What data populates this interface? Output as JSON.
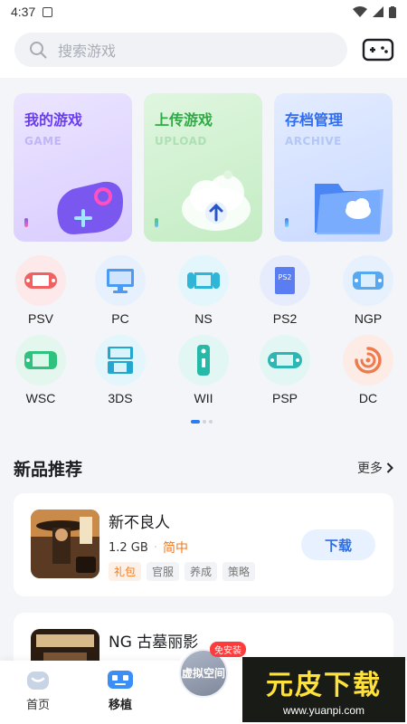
{
  "status": {
    "time": "4:37"
  },
  "search": {
    "placeholder": "搜索游戏"
  },
  "cards": [
    {
      "title": "我的游戏",
      "sub": "GAME"
    },
    {
      "title": "上传游戏",
      "sub": "UPLOAD"
    },
    {
      "title": "存档管理",
      "sub": "ARCHIVE"
    }
  ],
  "platforms": [
    {
      "label": "PSV",
      "icon": "psv-icon"
    },
    {
      "label": "PC",
      "icon": "monitor-icon"
    },
    {
      "label": "NS",
      "icon": "switch-icon"
    },
    {
      "label": "PS2",
      "icon": "ps2-icon"
    },
    {
      "label": "NGP",
      "icon": "ngp-icon"
    },
    {
      "label": "WSC",
      "icon": "wsc-icon"
    },
    {
      "label": "3DS",
      "icon": "3ds-icon"
    },
    {
      "label": "WII",
      "icon": "wii-icon"
    },
    {
      "label": "PSP",
      "icon": "psp-icon"
    },
    {
      "label": "DC",
      "icon": "dc-icon"
    }
  ],
  "section": {
    "title": "新品推荐",
    "more": "更多"
  },
  "games": [
    {
      "name": "新不良人",
      "size": "1.2 GB",
      "lang": "简中",
      "tags": [
        "礼包",
        "官服",
        "养成",
        "策略"
      ],
      "button": "下载"
    },
    {
      "name": "NG 古墓丽影",
      "size": "",
      "lang": "",
      "tags": [],
      "button": ""
    }
  ],
  "tabs": {
    "home": "首页",
    "port": "移植",
    "fab": "虚拟空间",
    "badge": "免安装"
  },
  "watermark": {
    "big": "元皮下载",
    "url": "www.yuanpi.com"
  }
}
